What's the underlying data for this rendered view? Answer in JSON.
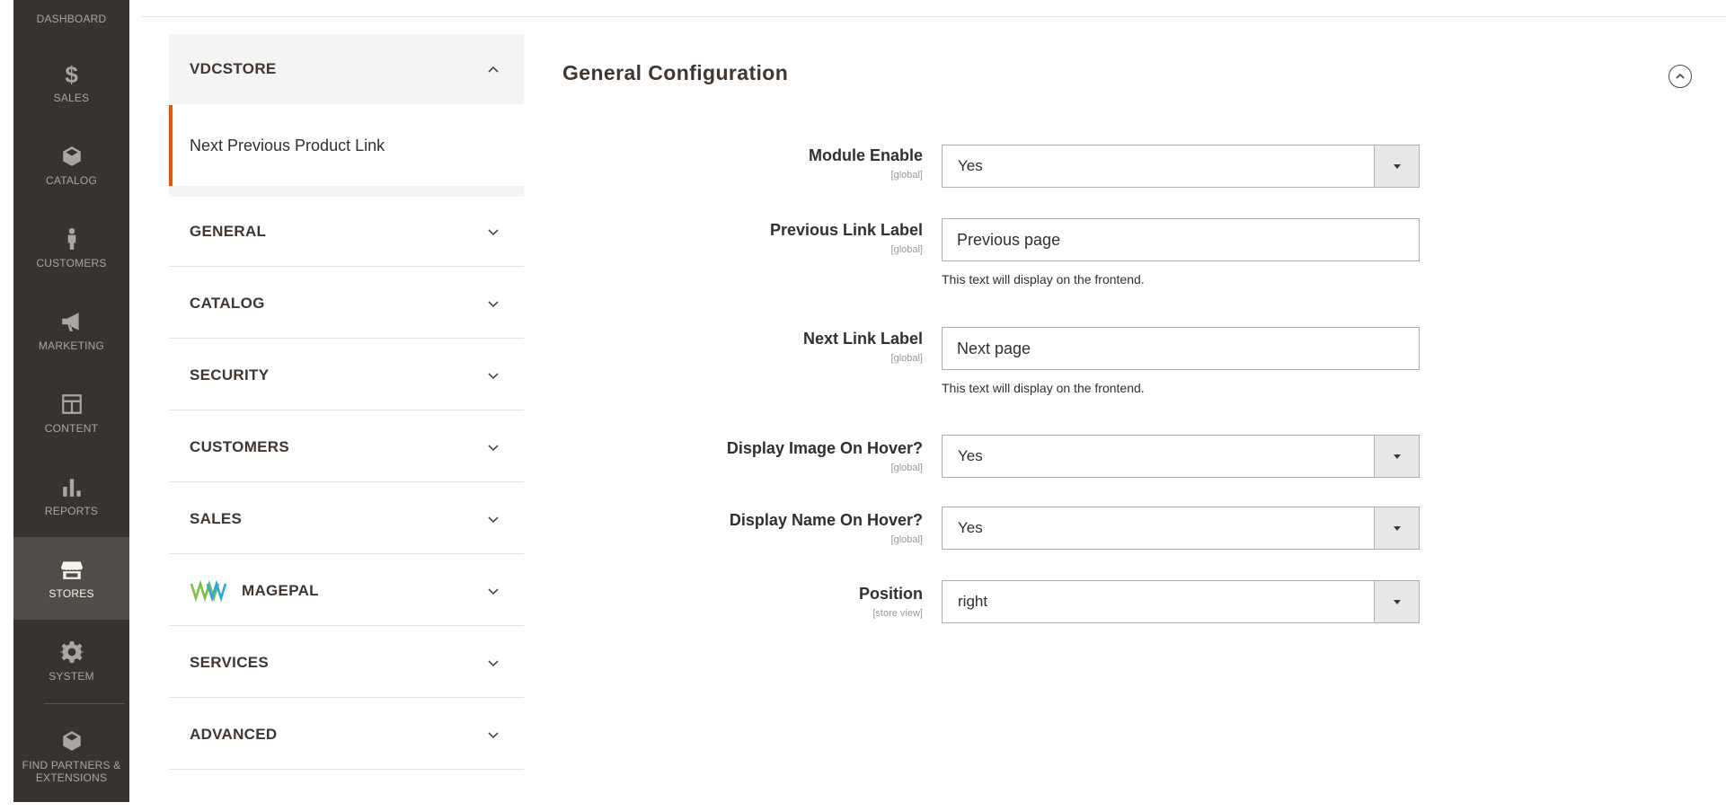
{
  "admin_nav": {
    "items": [
      {
        "label": "DASHBOARD",
        "icon": "dashboard-icon"
      },
      {
        "label": "SALES",
        "icon": "dollar-icon"
      },
      {
        "label": "CATALOG",
        "icon": "box-icon"
      },
      {
        "label": "CUSTOMERS",
        "icon": "person-icon"
      },
      {
        "label": "MARKETING",
        "icon": "megaphone-icon"
      },
      {
        "label": "CONTENT",
        "icon": "layout-icon"
      },
      {
        "label": "REPORTS",
        "icon": "bar-chart-icon"
      },
      {
        "label": "STORES",
        "icon": "storefront-icon"
      },
      {
        "label": "SYSTEM",
        "icon": "gear-icon"
      },
      {
        "label": "FIND PARTNERS & EXTENSIONS",
        "icon": "box-icon"
      }
    ],
    "active": "STORES"
  },
  "config_tabs": {
    "open_group": {
      "label": "VDCSTORE",
      "sub_item": "Next Previous Product Link"
    },
    "groups": [
      {
        "label": "GENERAL"
      },
      {
        "label": "CATALOG"
      },
      {
        "label": "SECURITY"
      },
      {
        "label": "CUSTOMERS"
      },
      {
        "label": "SALES"
      },
      {
        "label": "MAGEPAL",
        "logo": "magepal-logo"
      },
      {
        "label": "SERVICES"
      },
      {
        "label": "ADVANCED"
      }
    ]
  },
  "section": {
    "title": "General Configuration",
    "fields": [
      {
        "label": "Module Enable",
        "scope": "[global]",
        "type": "select",
        "value": "Yes"
      },
      {
        "label": "Previous Link Label",
        "scope": "[global]",
        "type": "text",
        "value": "Previous page",
        "note": "This text will display on the frontend."
      },
      {
        "label": "Next Link Label",
        "scope": "[global]",
        "type": "text",
        "value": "Next page",
        "note": "This text will display on the frontend."
      },
      {
        "label": "Display Image On Hover?",
        "scope": "[global]",
        "type": "select",
        "value": "Yes"
      },
      {
        "label": "Display Name On Hover?",
        "scope": "[global]",
        "type": "select",
        "value": "Yes"
      },
      {
        "label": "Position",
        "scope": "[store view]",
        "type": "select",
        "value": "right"
      }
    ]
  },
  "colors": {
    "nav_bg": "#373330",
    "nav_active_bg": "#524d49",
    "accent": "#eb5202",
    "tab_open_bg": "#f4f4f4"
  }
}
